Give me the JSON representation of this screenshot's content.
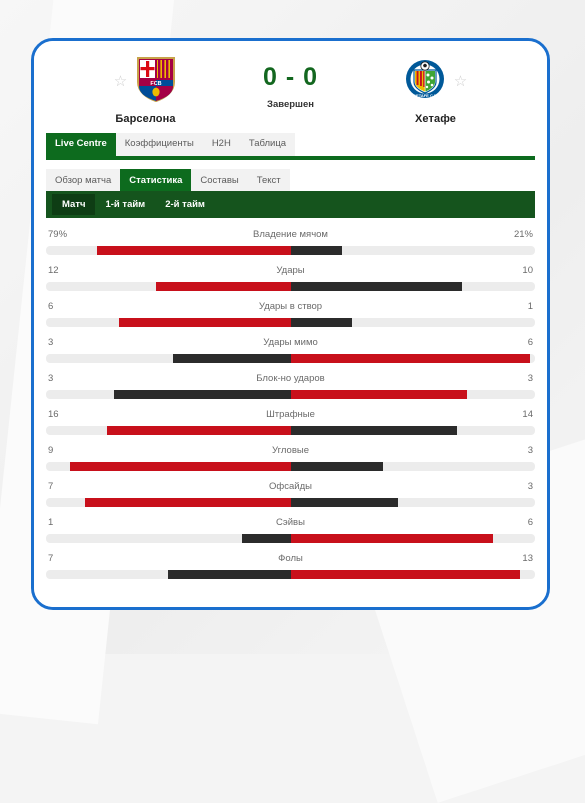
{
  "header": {
    "home": {
      "name": "Барселона",
      "crest": "barcelona-crest",
      "star": "☆"
    },
    "away": {
      "name": "Хетафе",
      "crest": "getafe-crest",
      "star": "☆"
    },
    "score": "0 - 0",
    "status": "Завершен",
    "score_color": "#13671f"
  },
  "primary_tabs": [
    {
      "label": "Live Centre",
      "active": true
    },
    {
      "label": "Коэффициенты",
      "active": false
    },
    {
      "label": "H2H",
      "active": false
    },
    {
      "label": "Таблица",
      "active": false
    }
  ],
  "secondary_tabs": [
    {
      "label": "Обзор матча",
      "active": false
    },
    {
      "label": "Статистика",
      "active": true
    },
    {
      "label": "Составы",
      "active": false
    },
    {
      "label": "Текст",
      "active": false
    }
  ],
  "period_tabs": [
    {
      "label": "Матч",
      "active": true
    },
    {
      "label": "1-й тайм",
      "active": false
    },
    {
      "label": "2-й тайм",
      "active": false
    }
  ],
  "theme": {
    "frame_border": "#1a6fce",
    "green_dark": "#0d6b1e",
    "green_bar": "#15541d",
    "green_active": "#0e3d14",
    "home_color": "#c8101b",
    "away_color": "#2b2b2b",
    "track_color": "#ececec"
  },
  "chart_data": {
    "type": "bar",
    "title": "Статистика",
    "subtitle": "Матч",
    "legend": [
      "Барселона",
      "Хетафе"
    ],
    "series": [
      {
        "name": "Барселона",
        "color": "#c8101b"
      },
      {
        "name": "Хетафе",
        "color": "#2b2b2b"
      }
    ],
    "categories": [
      "Владение мячом",
      "Удары",
      "Удары в створ",
      "Удары мимо",
      "Блок-но ударов",
      "Штрафные",
      "Угловые",
      "Офсайды",
      "Сэйвы",
      "Фолы"
    ],
    "rows": [
      {
        "label": "Владение мячом",
        "home": "79%",
        "away": "21%",
        "home_pct": 79,
        "away_pct": 21,
        "home_leads": true
      },
      {
        "label": "Удары",
        "home": "12",
        "away": "10",
        "home_pct": 55,
        "away_pct": 70,
        "home_leads": true
      },
      {
        "label": "Удары в створ",
        "home": "6",
        "away": "1",
        "home_pct": 70,
        "away_pct": 25,
        "home_leads": true
      },
      {
        "label": "Удары мимо",
        "home": "3",
        "away": "6",
        "home_pct": 48,
        "away_pct": 98,
        "home_leads": false
      },
      {
        "label": "Блок-но ударов",
        "home": "3",
        "away": "3",
        "home_pct": 72,
        "away_pct": 72,
        "home_leads": false
      },
      {
        "label": "Штрафные",
        "home": "16",
        "away": "14",
        "home_pct": 75,
        "away_pct": 68,
        "home_leads": true
      },
      {
        "label": "Угловые",
        "home": "9",
        "away": "3",
        "home_pct": 90,
        "away_pct": 38,
        "home_leads": true
      },
      {
        "label": "Офсайды",
        "home": "7",
        "away": "3",
        "home_pct": 84,
        "away_pct": 44,
        "home_leads": true
      },
      {
        "label": "Сэйвы",
        "home": "1",
        "away": "6",
        "home_pct": 20,
        "away_pct": 83,
        "home_leads": false
      },
      {
        "label": "Фолы",
        "home": "7",
        "away": "13",
        "home_pct": 50,
        "away_pct": 94,
        "home_leads": false
      }
    ],
    "xlabel": "",
    "ylabel": "",
    "grid": false,
    "legend_position": "implicit-left-right"
  }
}
